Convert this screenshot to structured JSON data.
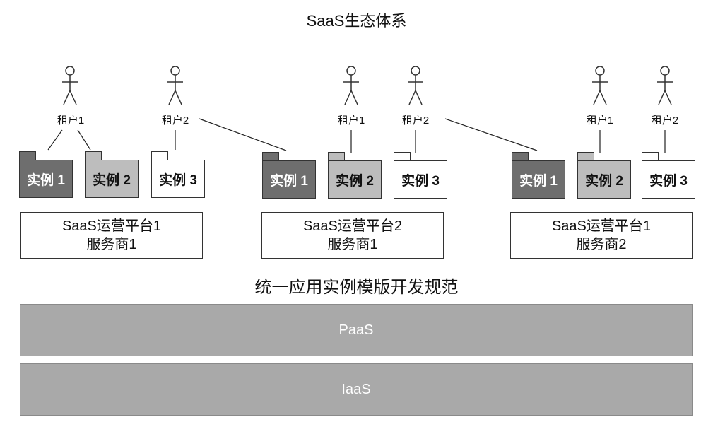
{
  "title": "SaaS生态体系",
  "groups": [
    {
      "actors": [
        "租户1",
        "租户2"
      ],
      "instances": [
        "实例 1",
        "实例 2",
        "实例 3"
      ],
      "platform": {
        "line1": "SaaS运营平台1",
        "line2": "服务商1"
      }
    },
    {
      "actors": [
        "租户1",
        "租户2"
      ],
      "instances": [
        "实例 1",
        "实例 2",
        "实例 3"
      ],
      "platform": {
        "line1": "SaaS运营平台2",
        "line2": "服务商1"
      }
    },
    {
      "actors": [
        "租户1",
        "租户2"
      ],
      "instances": [
        "实例 1",
        "实例 2",
        "实例 3"
      ],
      "platform": {
        "line1": "SaaS运营平台1",
        "line2": "服务商2"
      }
    }
  ],
  "spec": "统一应用实例模版开发规范",
  "layers": {
    "paas": "PaaS",
    "iaas": "IaaS"
  },
  "colors": {
    "instance_dark": "#6e6e6e",
    "instance_mid": "#bdbdbd",
    "instance_light": "#ffffff",
    "layer_fill": "#a9a9a9"
  }
}
